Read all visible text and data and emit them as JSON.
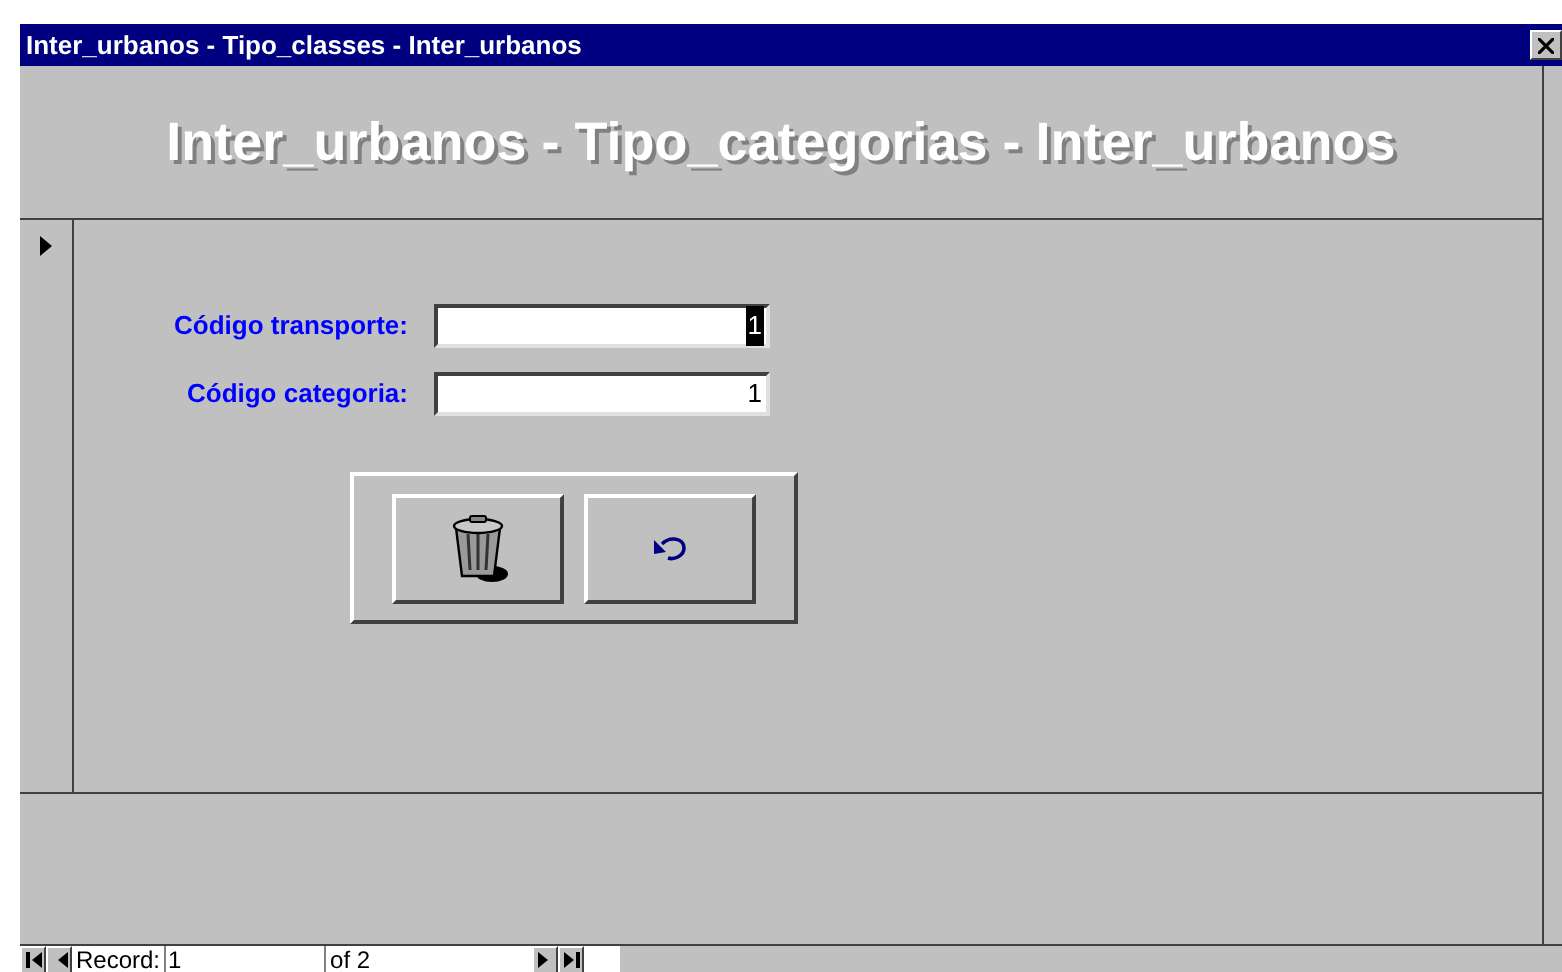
{
  "window": {
    "title": "Inter_urbanos - Tipo_classes - Inter_urbanos"
  },
  "header": {
    "title": "Inter_urbanos - Tipo_categorias - Inter_urbanos"
  },
  "fields": [
    {
      "label": "Código transporte:",
      "value": "1",
      "selected": true
    },
    {
      "label": "Código categoria:",
      "value": "1",
      "selected": false
    }
  ],
  "buttons": [
    {
      "kind": "delete"
    },
    {
      "kind": "undo"
    }
  ],
  "navigation": {
    "label": "Record:",
    "current": "1",
    "total": "of 2"
  }
}
